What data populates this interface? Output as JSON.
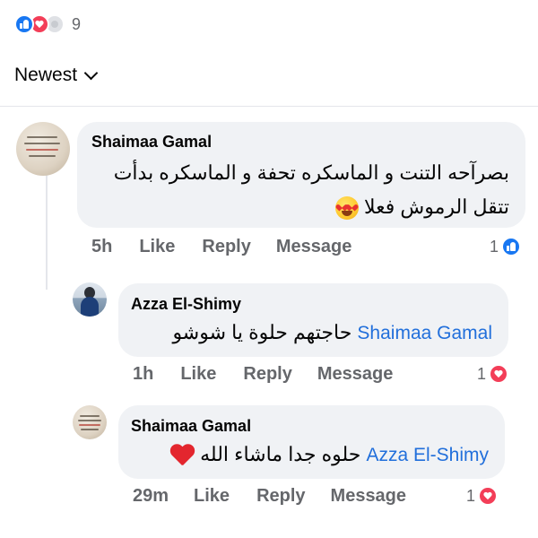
{
  "reactions": {
    "count": "9"
  },
  "sort": {
    "label": "Newest"
  },
  "comments": [
    {
      "author": "Shaimaa Gamal",
      "text": "بصرآحه التنت و الماسكره تحفة و الماسكره بدأت",
      "text2": "تتقل الرموش فعلا",
      "emoji": "heart-eyes-emoji",
      "time": "5h",
      "like_label": "Like",
      "reply_label": "Reply",
      "message_label": "Message",
      "reaction_count": "1",
      "reaction_type": "like"
    },
    {
      "author": "Azza El-Shimy",
      "mention": "Shaimaa Gamal",
      "text": "حاجتهم حلوة يا شوشو",
      "time": "1h",
      "like_label": "Like",
      "reply_label": "Reply",
      "message_label": "Message",
      "reaction_count": "1",
      "reaction_type": "love"
    },
    {
      "author": "Shaimaa Gamal",
      "mention": "Azza El-Shimy",
      "text": "حلوه جدا ماشاء الله",
      "emoji": "red-heart-emoji",
      "time": "29m",
      "like_label": "Like",
      "reply_label": "Reply",
      "message_label": "Message",
      "reaction_count": "1",
      "reaction_type": "love"
    }
  ],
  "colors": {
    "like_blue": "#1877f2",
    "love_red": "#f33e58",
    "link_blue": "#216fdb",
    "bubble_bg": "#f0f2f5",
    "meta_gray": "#65676b"
  }
}
